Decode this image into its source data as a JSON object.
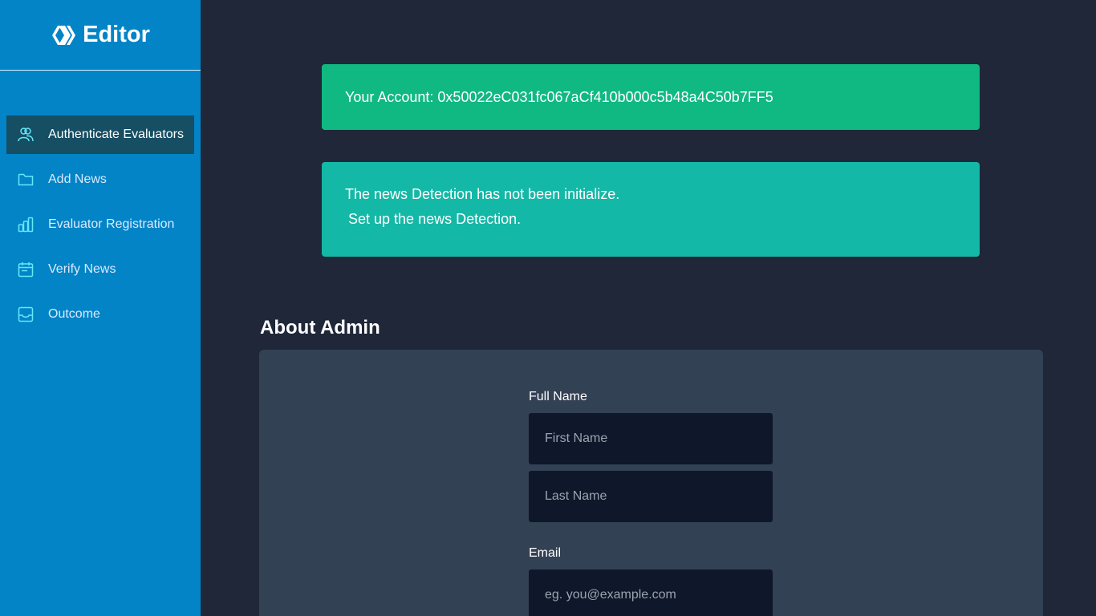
{
  "brand": {
    "title": "Editor",
    "icon": "hive-logo-icon"
  },
  "sidebar": {
    "items": [
      {
        "label": "Authenticate Evaluators",
        "icon": "users-icon",
        "active": true
      },
      {
        "label": "Add News",
        "icon": "folder-icon",
        "active": false
      },
      {
        "label": "Evaluator Registration",
        "icon": "bar-chart-icon",
        "active": false
      },
      {
        "label": "Verify News",
        "icon": "calendar-icon",
        "active": false
      },
      {
        "label": "Outcome",
        "icon": "inbox-icon",
        "active": false
      }
    ]
  },
  "alerts": {
    "account": "Your Account: 0x50022eC031fc067aCf410b000c5b48a4C50b7FF5",
    "init_line1": "The news Detection has not been initialize.",
    "init_line2": "Set up the news Detection."
  },
  "about": {
    "title": "About Admin",
    "full_name_label": "Full Name",
    "first_name_placeholder": "First Name",
    "last_name_placeholder": "Last Name",
    "email_label": "Email",
    "email_placeholder": "eg. you@example.com"
  },
  "colors": {
    "sidebar_bg": "#0284c7",
    "active_item_bg": "#164e63",
    "page_bg": "#1f2739",
    "success_alert": "#10b981",
    "info_alert": "#14b8a6",
    "card_bg": "#334155",
    "input_bg": "#0f172a",
    "icon_accent": "#67e8f9"
  }
}
